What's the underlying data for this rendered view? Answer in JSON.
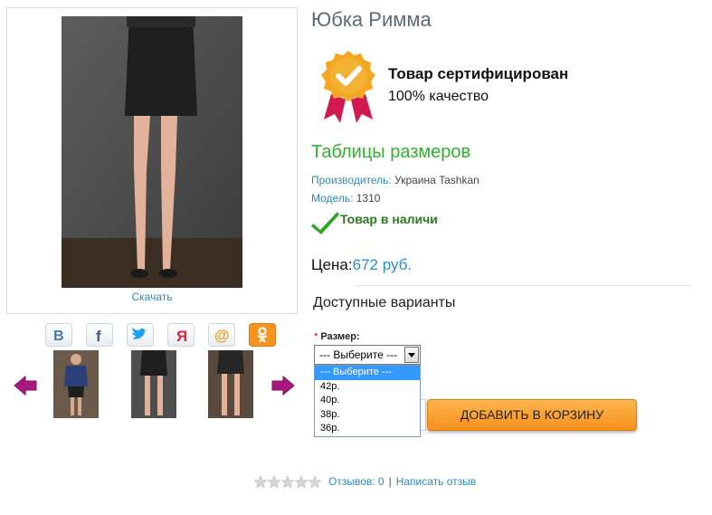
{
  "product": {
    "title": "Юбка Римма",
    "download_label": "Скачать",
    "certificate": {
      "title": "Товар сертифицирован",
      "subtitle": "100% качество"
    },
    "size_table_link": "Таблицы размеров",
    "manufacturer_label": "Производитель:",
    "manufacturer_value": "Украина Tashkan",
    "model_label": "Модель:",
    "model_value": "1310",
    "stock_status": "Товар в наличи",
    "price_label": "Цена:",
    "price_value": "672 руб."
  },
  "share_icons": [
    "vk-icon",
    "facebook-icon",
    "twitter-icon",
    "odnoklassniki-icon",
    "mail-at-icon",
    "ok-icon"
  ],
  "options": {
    "heading": "Доступные варианты",
    "required_mark": "*",
    "size_label": "Размер:",
    "selected": "--- Выберите ---",
    "items": [
      "--- Выберите ---",
      "42р.",
      "40р.",
      "38р.",
      "36р."
    ]
  },
  "cart": {
    "button_label": "ДОБАВИТЬ В КОРЗИНУ"
  },
  "reviews": {
    "rating": 0,
    "count_label": "Отзывов: 0",
    "separator": "|",
    "write_label": "Написать отзыв"
  },
  "colors": {
    "accent_blue": "#2a8ec0",
    "green": "#33b12e",
    "cart_orange": "#f7901e",
    "arrow_purple": "#a8177e"
  }
}
